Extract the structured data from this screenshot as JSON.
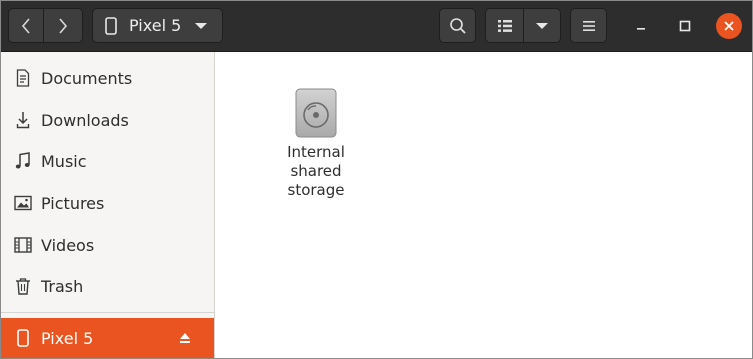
{
  "header": {
    "location_label": "Pixel 5",
    "icons": {
      "back": "chevron-left-icon",
      "forward": "chevron-right-icon",
      "device": "phone-icon",
      "location_dropdown": "caret-down-icon",
      "search": "search-icon",
      "view": "list-view-icon",
      "view_dropdown": "caret-down-icon",
      "menu": "hamburger-menu-icon",
      "minimize": "minimize-icon",
      "maximize": "maximize-icon",
      "close": "close-icon"
    }
  },
  "sidebar": {
    "items": [
      {
        "label": "Documents",
        "icon": "document-icon"
      },
      {
        "label": "Downloads",
        "icon": "download-icon"
      },
      {
        "label": "Music",
        "icon": "music-note-icon"
      },
      {
        "label": "Pictures",
        "icon": "picture-icon"
      },
      {
        "label": "Videos",
        "icon": "film-icon"
      },
      {
        "label": "Trash",
        "icon": "trash-icon"
      }
    ],
    "device": {
      "label": "Pixel 5",
      "icon": "phone-icon",
      "action_icon": "eject-icon",
      "selected": true
    }
  },
  "content": {
    "items": [
      {
        "label": "Internal shared storage",
        "icon": "drive-icon"
      }
    ]
  },
  "colors": {
    "headerbar": "#2d2d2d",
    "accent": "#e95420",
    "sidebar_bg": "#f6f5f4",
    "content_bg": "#ffffff"
  }
}
